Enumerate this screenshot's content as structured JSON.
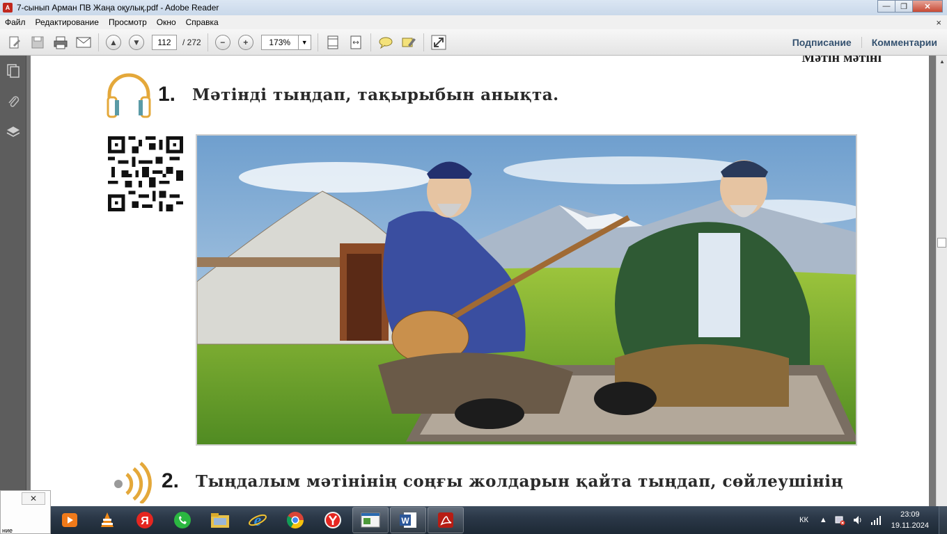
{
  "window": {
    "title": "7-сынып Арман ПВ Жаңа оқулық.pdf - Adobe Reader"
  },
  "menu": {
    "items": [
      "Файл",
      "Редактирование",
      "Просмотр",
      "Окно",
      "Справка"
    ],
    "close_glyph": "×"
  },
  "toolbar": {
    "page_current": "112",
    "page_total": "/ 272",
    "zoom": "173%",
    "sign_label": "Подписание",
    "comment_label": "Комментарии"
  },
  "document": {
    "cut_text": "Мәтін мәтіні",
    "task1": {
      "number": "1.",
      "text": "Мәтінді тыңдап, тақырыбын анықта."
    },
    "task2": {
      "number": "2.",
      "text": "Тыңдалым мәтінінің соңғы жолдарын қайта тыңдап, сөйлеушінің"
    }
  },
  "popup": {
    "close_glyph": "✕",
    "text": "ние"
  },
  "taskbar": {
    "language": "КК",
    "time": "23:09",
    "date": "19.11.2024",
    "apps": [
      "media-player",
      "vlc",
      "yandex-y",
      "whatsapp",
      "file-explorer",
      "internet-explorer",
      "chrome",
      "yandex-browser",
      "presentation",
      "word",
      "adobe-reader"
    ]
  }
}
